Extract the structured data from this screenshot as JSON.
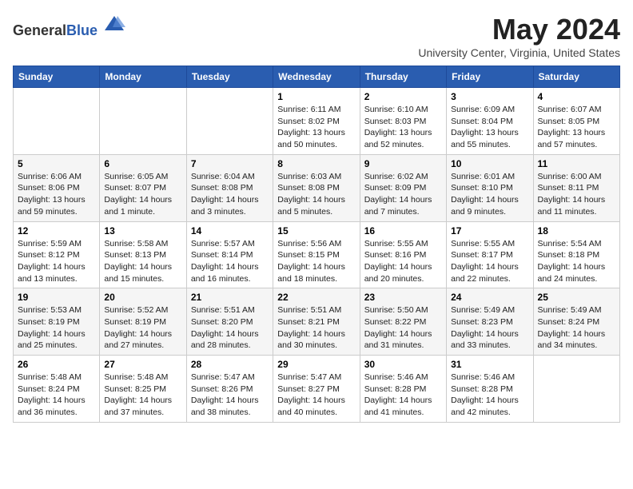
{
  "header": {
    "logo_general": "General",
    "logo_blue": "Blue",
    "month_title": "May 2024",
    "location": "University Center, Virginia, United States"
  },
  "days_of_week": [
    "Sunday",
    "Monday",
    "Tuesday",
    "Wednesday",
    "Thursday",
    "Friday",
    "Saturday"
  ],
  "weeks": [
    [
      {
        "day": "",
        "sunrise": "",
        "sunset": "",
        "daylight": ""
      },
      {
        "day": "",
        "sunrise": "",
        "sunset": "",
        "daylight": ""
      },
      {
        "day": "",
        "sunrise": "",
        "sunset": "",
        "daylight": ""
      },
      {
        "day": "1",
        "sunrise": "Sunrise: 6:11 AM",
        "sunset": "Sunset: 8:02 PM",
        "daylight": "Daylight: 13 hours and 50 minutes."
      },
      {
        "day": "2",
        "sunrise": "Sunrise: 6:10 AM",
        "sunset": "Sunset: 8:03 PM",
        "daylight": "Daylight: 13 hours and 52 minutes."
      },
      {
        "day": "3",
        "sunrise": "Sunrise: 6:09 AM",
        "sunset": "Sunset: 8:04 PM",
        "daylight": "Daylight: 13 hours and 55 minutes."
      },
      {
        "day": "4",
        "sunrise": "Sunrise: 6:07 AM",
        "sunset": "Sunset: 8:05 PM",
        "daylight": "Daylight: 13 hours and 57 minutes."
      }
    ],
    [
      {
        "day": "5",
        "sunrise": "Sunrise: 6:06 AM",
        "sunset": "Sunset: 8:06 PM",
        "daylight": "Daylight: 13 hours and 59 minutes."
      },
      {
        "day": "6",
        "sunrise": "Sunrise: 6:05 AM",
        "sunset": "Sunset: 8:07 PM",
        "daylight": "Daylight: 14 hours and 1 minute."
      },
      {
        "day": "7",
        "sunrise": "Sunrise: 6:04 AM",
        "sunset": "Sunset: 8:08 PM",
        "daylight": "Daylight: 14 hours and 3 minutes."
      },
      {
        "day": "8",
        "sunrise": "Sunrise: 6:03 AM",
        "sunset": "Sunset: 8:08 PM",
        "daylight": "Daylight: 14 hours and 5 minutes."
      },
      {
        "day": "9",
        "sunrise": "Sunrise: 6:02 AM",
        "sunset": "Sunset: 8:09 PM",
        "daylight": "Daylight: 14 hours and 7 minutes."
      },
      {
        "day": "10",
        "sunrise": "Sunrise: 6:01 AM",
        "sunset": "Sunset: 8:10 PM",
        "daylight": "Daylight: 14 hours and 9 minutes."
      },
      {
        "day": "11",
        "sunrise": "Sunrise: 6:00 AM",
        "sunset": "Sunset: 8:11 PM",
        "daylight": "Daylight: 14 hours and 11 minutes."
      }
    ],
    [
      {
        "day": "12",
        "sunrise": "Sunrise: 5:59 AM",
        "sunset": "Sunset: 8:12 PM",
        "daylight": "Daylight: 14 hours and 13 minutes."
      },
      {
        "day": "13",
        "sunrise": "Sunrise: 5:58 AM",
        "sunset": "Sunset: 8:13 PM",
        "daylight": "Daylight: 14 hours and 15 minutes."
      },
      {
        "day": "14",
        "sunrise": "Sunrise: 5:57 AM",
        "sunset": "Sunset: 8:14 PM",
        "daylight": "Daylight: 14 hours and 16 minutes."
      },
      {
        "day": "15",
        "sunrise": "Sunrise: 5:56 AM",
        "sunset": "Sunset: 8:15 PM",
        "daylight": "Daylight: 14 hours and 18 minutes."
      },
      {
        "day": "16",
        "sunrise": "Sunrise: 5:55 AM",
        "sunset": "Sunset: 8:16 PM",
        "daylight": "Daylight: 14 hours and 20 minutes."
      },
      {
        "day": "17",
        "sunrise": "Sunrise: 5:55 AM",
        "sunset": "Sunset: 8:17 PM",
        "daylight": "Daylight: 14 hours and 22 minutes."
      },
      {
        "day": "18",
        "sunrise": "Sunrise: 5:54 AM",
        "sunset": "Sunset: 8:18 PM",
        "daylight": "Daylight: 14 hours and 24 minutes."
      }
    ],
    [
      {
        "day": "19",
        "sunrise": "Sunrise: 5:53 AM",
        "sunset": "Sunset: 8:19 PM",
        "daylight": "Daylight: 14 hours and 25 minutes."
      },
      {
        "day": "20",
        "sunrise": "Sunrise: 5:52 AM",
        "sunset": "Sunset: 8:19 PM",
        "daylight": "Daylight: 14 hours and 27 minutes."
      },
      {
        "day": "21",
        "sunrise": "Sunrise: 5:51 AM",
        "sunset": "Sunset: 8:20 PM",
        "daylight": "Daylight: 14 hours and 28 minutes."
      },
      {
        "day": "22",
        "sunrise": "Sunrise: 5:51 AM",
        "sunset": "Sunset: 8:21 PM",
        "daylight": "Daylight: 14 hours and 30 minutes."
      },
      {
        "day": "23",
        "sunrise": "Sunrise: 5:50 AM",
        "sunset": "Sunset: 8:22 PM",
        "daylight": "Daylight: 14 hours and 31 minutes."
      },
      {
        "day": "24",
        "sunrise": "Sunrise: 5:49 AM",
        "sunset": "Sunset: 8:23 PM",
        "daylight": "Daylight: 14 hours and 33 minutes."
      },
      {
        "day": "25",
        "sunrise": "Sunrise: 5:49 AM",
        "sunset": "Sunset: 8:24 PM",
        "daylight": "Daylight: 14 hours and 34 minutes."
      }
    ],
    [
      {
        "day": "26",
        "sunrise": "Sunrise: 5:48 AM",
        "sunset": "Sunset: 8:24 PM",
        "daylight": "Daylight: 14 hours and 36 minutes."
      },
      {
        "day": "27",
        "sunrise": "Sunrise: 5:48 AM",
        "sunset": "Sunset: 8:25 PM",
        "daylight": "Daylight: 14 hours and 37 minutes."
      },
      {
        "day": "28",
        "sunrise": "Sunrise: 5:47 AM",
        "sunset": "Sunset: 8:26 PM",
        "daylight": "Daylight: 14 hours and 38 minutes."
      },
      {
        "day": "29",
        "sunrise": "Sunrise: 5:47 AM",
        "sunset": "Sunset: 8:27 PM",
        "daylight": "Daylight: 14 hours and 40 minutes."
      },
      {
        "day": "30",
        "sunrise": "Sunrise: 5:46 AM",
        "sunset": "Sunset: 8:28 PM",
        "daylight": "Daylight: 14 hours and 41 minutes."
      },
      {
        "day": "31",
        "sunrise": "Sunrise: 5:46 AM",
        "sunset": "Sunset: 8:28 PM",
        "daylight": "Daylight: 14 hours and 42 minutes."
      },
      {
        "day": "",
        "sunrise": "",
        "sunset": "",
        "daylight": ""
      }
    ]
  ]
}
